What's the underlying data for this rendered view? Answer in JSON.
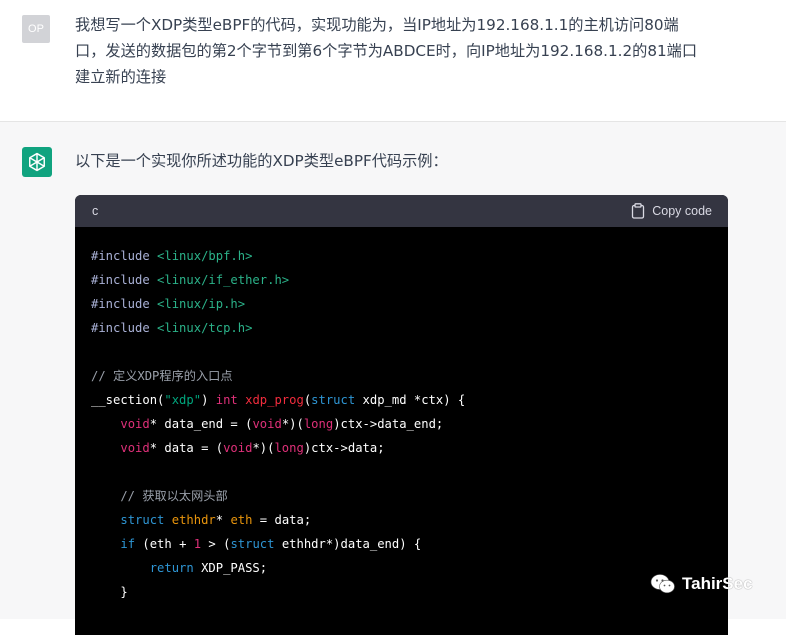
{
  "user": {
    "avatar_initials": "OP",
    "message": "我想写一个XDP类型eBPF的代码，实现功能为，当IP地址为192.168.1.1的主机访问80端\n口，发送的数据包的第2个字节到第6个字节为ABDCE时，向IP地址为192.168.1.2的81端口\n建立新的连接"
  },
  "assistant": {
    "avatar_icon": "openai-logo-icon",
    "intro": "以下是一个实现你所述功能的XDP类型eBPF代码示例：",
    "code_block": {
      "language": "c",
      "copy_label": "Copy code",
      "copy_icon": "clipboard-icon",
      "lines": [
        [
          {
            "t": "#include ",
            "c": "preproc"
          },
          {
            "t": "<linux/bpf.h>",
            "c": "inc"
          }
        ],
        [
          {
            "t": "#include ",
            "c": "preproc"
          },
          {
            "t": "<linux/if_ether.h>",
            "c": "inc"
          }
        ],
        [
          {
            "t": "#include ",
            "c": "preproc"
          },
          {
            "t": "<linux/ip.h>",
            "c": "inc"
          }
        ],
        [
          {
            "t": "#include ",
            "c": "preproc"
          },
          {
            "t": "<linux/tcp.h>",
            "c": "inc"
          }
        ],
        [],
        [
          {
            "t": "// 定义XDP程序的入口点",
            "c": "comment"
          }
        ],
        [
          {
            "t": "__section(",
            "c": "plain"
          },
          {
            "t": "\"xdp\"",
            "c": "str"
          },
          {
            "t": ") ",
            "c": "plain"
          },
          {
            "t": "int",
            "c": "type"
          },
          {
            "t": " ",
            "c": "plain"
          },
          {
            "t": "xdp_prog",
            "c": "func"
          },
          {
            "t": "(",
            "c": "plain"
          },
          {
            "t": "struct",
            "c": "kw"
          },
          {
            "t": " xdp_md *ctx) {",
            "c": "plain"
          }
        ],
        [
          {
            "t": "    ",
            "c": "plain"
          },
          {
            "t": "void",
            "c": "type"
          },
          {
            "t": "* data_end = (",
            "c": "plain"
          },
          {
            "t": "void",
            "c": "type"
          },
          {
            "t": "*)(",
            "c": "plain"
          },
          {
            "t": "long",
            "c": "type"
          },
          {
            "t": ")ctx->data_end;",
            "c": "plain"
          }
        ],
        [
          {
            "t": "    ",
            "c": "plain"
          },
          {
            "t": "void",
            "c": "type"
          },
          {
            "t": "* data = (",
            "c": "plain"
          },
          {
            "t": "void",
            "c": "type"
          },
          {
            "t": "*)(",
            "c": "plain"
          },
          {
            "t": "long",
            "c": "type"
          },
          {
            "t": ")ctx->data;",
            "c": "plain"
          }
        ],
        [],
        [
          {
            "t": "    // 获取以太网头部",
            "c": "comment"
          }
        ],
        [
          {
            "t": "    ",
            "c": "plain"
          },
          {
            "t": "struct",
            "c": "kw"
          },
          {
            "t": " ",
            "c": "plain"
          },
          {
            "t": "ethhdr",
            "c": "var"
          },
          {
            "t": "* ",
            "c": "plain"
          },
          {
            "t": "eth",
            "c": "var"
          },
          {
            "t": " = data;",
            "c": "plain"
          }
        ],
        [
          {
            "t": "    ",
            "c": "plain"
          },
          {
            "t": "if",
            "c": "kw"
          },
          {
            "t": " (eth + ",
            "c": "plain"
          },
          {
            "t": "1",
            "c": "num"
          },
          {
            "t": " > (",
            "c": "plain"
          },
          {
            "t": "struct",
            "c": "kw"
          },
          {
            "t": " ethhdr*)data_end) {",
            "c": "plain"
          }
        ],
        [
          {
            "t": "        ",
            "c": "plain"
          },
          {
            "t": "return",
            "c": "kw"
          },
          {
            "t": " XDP_PASS;",
            "c": "plain"
          }
        ],
        [
          {
            "t": "    }",
            "c": "plain"
          }
        ]
      ]
    }
  },
  "watermark": {
    "icon": "wechat-icon",
    "text": "TahirSec"
  }
}
